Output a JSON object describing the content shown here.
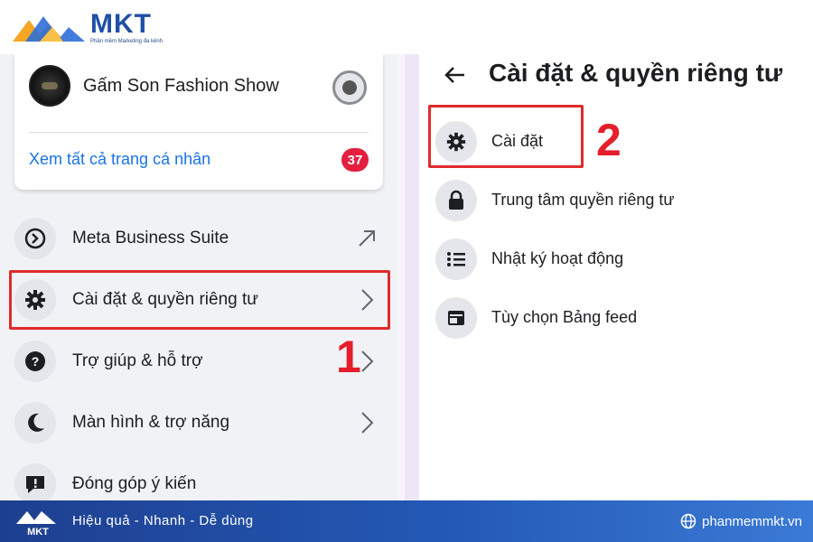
{
  "brand": {
    "name": "MKT",
    "tagline": "Phần mềm Marketing đa kênh"
  },
  "left_panel": {
    "profile_name": "Gấm Son Fashion Show",
    "see_all": "Xem tất cả trang cá nhân",
    "badge_count": "37",
    "menu": [
      {
        "label": "Meta Business Suite",
        "icon": "meta-business-icon",
        "trail": "external-arrow-icon"
      },
      {
        "label": "Cài đặt & quyền riêng tư",
        "icon": "gear-icon",
        "trail": "chevron-right-icon"
      },
      {
        "label": "Trợ giúp & hỗ trợ",
        "icon": "question-icon",
        "trail": "chevron-right-icon"
      },
      {
        "label": "Màn hình & trợ năng",
        "icon": "moon-icon",
        "trail": "chevron-right-icon"
      },
      {
        "label": "Đóng góp ý kiến",
        "icon": "feedback-icon",
        "trail": ""
      }
    ]
  },
  "right_panel": {
    "title": "Cài đặt & quyền riêng tư",
    "items": [
      {
        "label": "Cài đặt",
        "icon": "gear-icon"
      },
      {
        "label": "Trung tâm quyền riêng tư",
        "icon": "lock-icon"
      },
      {
        "label": "Nhật ký hoạt động",
        "icon": "list-icon"
      },
      {
        "label": "Tùy chọn Bảng feed",
        "icon": "feed-icon"
      }
    ]
  },
  "annotations": {
    "step1": "1",
    "step2": "2",
    "highlight_color": "#e02a2a"
  },
  "footer": {
    "slogan": "Hiệu quả - Nhanh  - Dễ dùng",
    "website": "phanmemmkt.vn"
  },
  "colors": {
    "link": "#1b74e4",
    "badge": "#e41e3f",
    "footer_start": "#1e3f8f",
    "footer_end": "#3b7ad6"
  }
}
